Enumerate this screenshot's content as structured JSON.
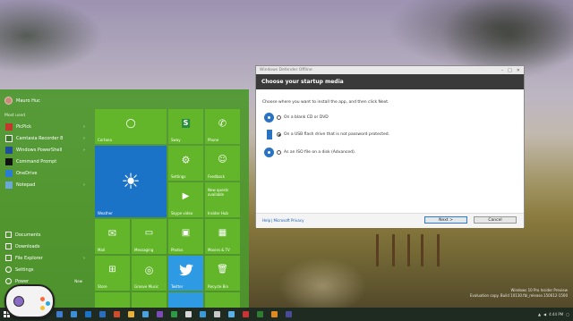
{
  "window_title": "Windows Defender Offline",
  "dialog": {
    "title": "Windows Defender Offline",
    "heading": "Choose your startup media",
    "instruction": "Choose where you want to install the app, and then click Next.",
    "options": [
      {
        "label": "On a blank CD or DVD",
        "selected": false,
        "icon": "disc-icon"
      },
      {
        "label": "On a USB flash drive that is not password protected.",
        "selected": true,
        "icon": "usb-drive-icon"
      },
      {
        "label": "As an ISO file on a disk (Advanced).",
        "selected": false,
        "icon": "iso-disc-icon"
      }
    ],
    "help_link": "Help",
    "separator": "|",
    "privacy_link": "Microsoft Privacy",
    "next_button": "Next >",
    "cancel_button": "Cancel"
  },
  "start_menu": {
    "user_name": "Mauro Huc",
    "most_used_label": "Most used",
    "apps": [
      {
        "label": "PicPick",
        "color": "#c0392b"
      },
      {
        "label": "Camtasia Recorder 8",
        "color": "#3a7a2a"
      },
      {
        "label": "Windows PowerShell",
        "color": "#1f4e99"
      },
      {
        "label": "Command Prompt",
        "color": "#111111"
      },
      {
        "label": "OneDrive",
        "color": "#2b7cd3"
      },
      {
        "label": "Notepad",
        "color": "#6aa8d8"
      }
    ],
    "places": [
      {
        "label": "Documents"
      },
      {
        "label": "Downloads"
      },
      {
        "label": "File Explorer"
      },
      {
        "label": "Settings"
      },
      {
        "label": "Power"
      }
    ],
    "new_label": "New",
    "tiles": {
      "cortana": "Cortana",
      "sway": "Sway",
      "phone": "Phone",
      "weather": "Weather",
      "settings": "Settings",
      "feedback": "Feedback",
      "skype_video": "Skype video",
      "insider_hub": "Insider Hub",
      "insider_hub_text": "New quests available",
      "mail": "Mail",
      "messaging": "Messaging",
      "photos": "Photos",
      "movies_tv": "Movies & TV",
      "store": "Store",
      "groove_music": "Groove Music",
      "twitter": "Twitter",
      "recycle_bin": "Recycle Bin"
    }
  },
  "watermark": {
    "line1": "Windows 10 Pro Insider Preview",
    "line2": "Evaluation copy. Build 10130.fbl_release.150612-1500"
  },
  "taskbar": {
    "icon_colors": [
      "#3d7dd1",
      "#3b8ed8",
      "#1a73c6",
      "#2a6ec0",
      "#d44b2c",
      "#e8b23a",
      "#4aa3df",
      "#7b4bb8",
      "#2d9b45",
      "#d8d8d8",
      "#3a9ad9",
      "#c8c8c8",
      "#5ab0e8",
      "#cc3333",
      "#2d7d33",
      "#e28a1f",
      "#4a4a9a"
    ],
    "tray_time": "4:44 PM"
  },
  "colors": {
    "start_menu_green": "#4e982e",
    "tile_green": "#63b62a",
    "tile_blue": "#1b73c7",
    "dialog_header": "#3a3a3a",
    "accent_blue": "#2d7bd6"
  }
}
